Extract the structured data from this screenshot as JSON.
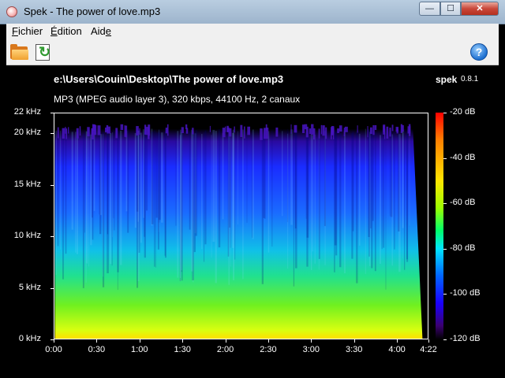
{
  "window": {
    "title": "Spek - The power of love.mp3",
    "min": "—",
    "max": "☐",
    "close": "✕"
  },
  "menu": [
    {
      "label": "ichier",
      "accel": "F"
    },
    {
      "label": "dition",
      "accel": "É"
    },
    {
      "label": "Aid",
      "accel": "e",
      "accel_suffix": true
    }
  ],
  "toolbar": {
    "open": "folder-icon",
    "save": "save-icon",
    "help": "?"
  },
  "spek": {
    "file": "e:\\Users\\Couin\\Desktop\\The power of love.mp3",
    "app": "spek",
    "version": "0.8.1",
    "info": "MP3 (MPEG audio layer 3), 320 kbps, 44100 Hz, 2 canaux"
  },
  "chart_data": {
    "type": "heatmap",
    "y_ticks": [
      "22 kHz",
      "20 kHz",
      "15 kHz",
      "10 kHz",
      "5 kHz",
      "0 kHz"
    ],
    "y_values_khz": [
      22,
      20,
      15,
      10,
      5,
      0
    ],
    "x_ticks": [
      "0:00",
      "0:30",
      "1:00",
      "1:30",
      "2:00",
      "2:30",
      "3:00",
      "3:30",
      "4:00",
      "4:22"
    ],
    "x_values_s": [
      0,
      30,
      60,
      90,
      120,
      150,
      180,
      210,
      240,
      262
    ],
    "duration_s": 262,
    "ylim_khz": [
      0,
      22
    ],
    "color_scale_labels": [
      "-20 dB",
      "-40 dB",
      "-60 dB",
      "-80 dB",
      "-100 dB",
      "-120 dB"
    ],
    "color_scale_db": [
      -20,
      -40,
      -60,
      -80,
      -100,
      -120
    ],
    "audio_cutoff_khz": 20.5,
    "audio_end_s": 252
  }
}
